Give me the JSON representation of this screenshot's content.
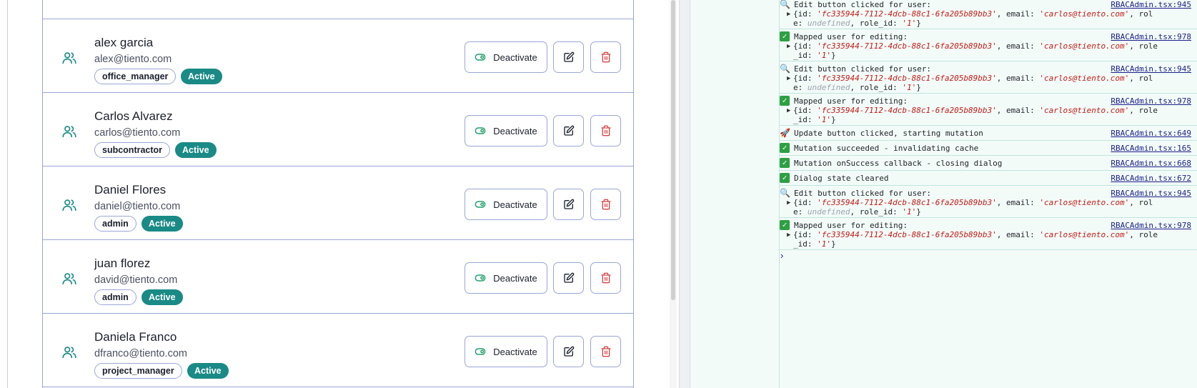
{
  "users": [
    {
      "name": "alex garcia",
      "email": "alex@tiento.com",
      "role": "office_manager",
      "status": "Active"
    },
    {
      "name": "Carlos Alvarez",
      "email": "carlos@tiento.com",
      "role": "subcontractor",
      "status": "Active"
    },
    {
      "name": "Daniel Flores",
      "email": "daniel@tiento.com",
      "role": "admin",
      "status": "Active"
    },
    {
      "name": "juan florez",
      "email": "david@tiento.com",
      "role": "admin",
      "status": "Active"
    },
    {
      "name": "Daniela Franco",
      "email": "dfranco@tiento.com",
      "role": "project_manager",
      "status": "Active"
    }
  ],
  "actions": {
    "deactivate_label": "Deactivate"
  },
  "icons": {
    "user": "users-icon",
    "toggle": "toggle-icon",
    "edit": "edit-icon",
    "delete": "trash-icon"
  },
  "colors": {
    "accent": "#1a8a86",
    "danger": "#d64545",
    "toggle": "#22a06b",
    "link": "#1a1f8a"
  },
  "console": {
    "entries": [
      {
        "glyph": "🔍",
        "text": "Edit button clicked for user:",
        "src": "RBACAdmin.tsx:945",
        "obj1": "{id: 'fc335944-7112-4dcb-88c1-6fa205b89bb3', email: 'carlos@tiento.com', rol",
        "obj2": "e: undefined, role_id: '1'}"
      },
      {
        "glyph": "✓",
        "text": "Mapped user for editing:",
        "src": "RBACAdmin.tsx:978",
        "obj1": "{id: 'fc335944-7112-4dcb-88c1-6fa205b89bb3', email: 'carlos@tiento.com', role",
        "obj2": "_id: '1'}"
      },
      {
        "glyph": "🔍",
        "text": "Edit button clicked for user:",
        "src": "RBACAdmin.tsx:945",
        "obj1": "{id: 'fc335944-7112-4dcb-88c1-6fa205b89bb3', email: 'carlos@tiento.com', rol",
        "obj2": "e: undefined, role_id: '1'}"
      },
      {
        "glyph": "✓",
        "text": "Mapped user for editing:",
        "src": "RBACAdmin.tsx:978",
        "obj1": "{id: 'fc335944-7112-4dcb-88c1-6fa205b89bb3', email: 'carlos@tiento.com', role",
        "obj2": "_id: '1'}"
      },
      {
        "glyph": "🚀",
        "text": "Update button clicked, starting mutation",
        "src": "RBACAdmin.tsx:649"
      },
      {
        "glyph": "✓",
        "text": "Mutation succeeded - invalidating cache",
        "src": "RBACAdmin.tsx:165"
      },
      {
        "glyph": "✓",
        "text": "Mutation onSuccess callback - closing dialog",
        "src": "RBACAdmin.tsx:668"
      },
      {
        "glyph": "✓",
        "text": "Dialog state cleared",
        "src": "RBACAdmin.tsx:672"
      },
      {
        "glyph": "🔍",
        "text": "Edit button clicked for user:",
        "src": "RBACAdmin.tsx:945",
        "obj1": "{id: 'fc335944-7112-4dcb-88c1-6fa205b89bb3', email: 'carlos@tiento.com', rol",
        "obj2": "e: undefined, role_id: '1'}"
      },
      {
        "glyph": "✓",
        "text": "Mapped user for editing:",
        "src": "RBACAdmin.tsx:978",
        "obj1": "{id: 'fc335944-7112-4dcb-88c1-6fa205b89bb3', email: 'carlos@tiento.com', role",
        "obj2": "_id: '1'}"
      }
    ],
    "prompt_caret": "›"
  }
}
